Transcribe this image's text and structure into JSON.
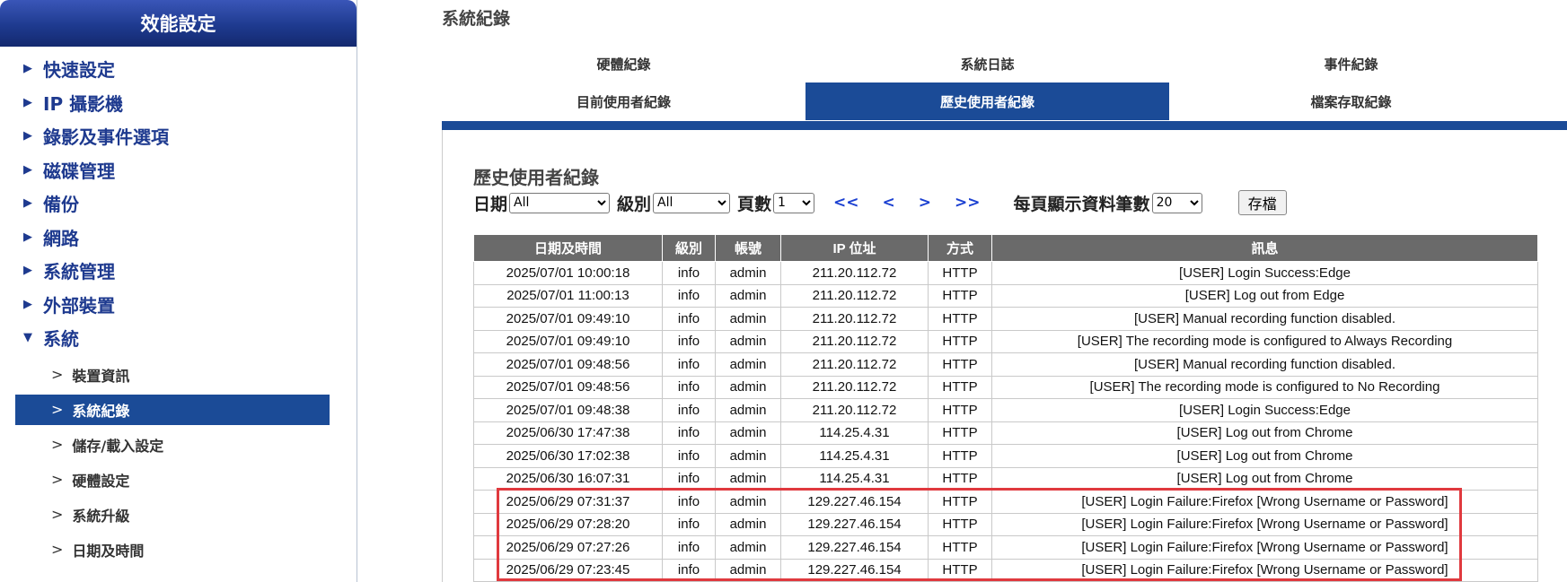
{
  "sidebar": {
    "title": "效能設定",
    "menu": [
      {
        "label": "快速設定"
      },
      {
        "label": "IP 攝影機"
      },
      {
        "label": "錄影及事件選項"
      },
      {
        "label": "磁碟管理"
      },
      {
        "label": "備份"
      },
      {
        "label": "網路"
      },
      {
        "label": "系統管理"
      },
      {
        "label": "外部裝置"
      },
      {
        "label": "系統"
      }
    ],
    "submenu": [
      {
        "label": "裝置資訊"
      },
      {
        "label": "系統紀錄"
      },
      {
        "label": "儲存/載入設定"
      },
      {
        "label": "硬體設定"
      },
      {
        "label": "系統升級"
      },
      {
        "label": "日期及時間"
      }
    ]
  },
  "page_title": "系統紀錄",
  "tabs": {
    "row1": [
      "硬體紀錄",
      "系統日誌",
      "事件紀錄"
    ],
    "row2": [
      "目前使用者紀錄",
      "歷史使用者紀錄",
      "檔案存取紀錄"
    ]
  },
  "section_title": "歷史使用者紀錄",
  "controls": {
    "date_label": "日期",
    "date_value": "All",
    "level_label": "級別",
    "level_value": "All",
    "page_label": "頁數",
    "page_value": "1",
    "first": "<<",
    "prev": "<",
    "next": ">",
    "last": ">>",
    "per_page_label": "每頁顯示資料筆數",
    "per_page_value": "20",
    "save_label": "存檔"
  },
  "table": {
    "headers": [
      "日期及時間",
      "級別",
      "帳號",
      "IP 位址",
      "方式",
      "訊息"
    ],
    "rows": [
      [
        "2025/07/01 10:00:18",
        "info",
        "admin",
        "211.20.112.72",
        "HTTP",
        "[USER] Login Success:Edge"
      ],
      [
        "2025/07/01 11:00:13",
        "info",
        "admin",
        "211.20.112.72",
        "HTTP",
        "[USER] Log out from Edge"
      ],
      [
        "2025/07/01 09:49:10",
        "info",
        "admin",
        "211.20.112.72",
        "HTTP",
        "[USER] Manual recording function disabled."
      ],
      [
        "2025/07/01 09:49:10",
        "info",
        "admin",
        "211.20.112.72",
        "HTTP",
        "[USER] The recording mode is configured to Always Recording"
      ],
      [
        "2025/07/01 09:48:56",
        "info",
        "admin",
        "211.20.112.72",
        "HTTP",
        "[USER] Manual recording function disabled."
      ],
      [
        "2025/07/01 09:48:56",
        "info",
        "admin",
        "211.20.112.72",
        "HTTP",
        "[USER] The recording mode is configured to No Recording"
      ],
      [
        "2025/07/01 09:48:38",
        "info",
        "admin",
        "211.20.112.72",
        "HTTP",
        "[USER] Login Success:Edge"
      ],
      [
        "2025/06/30 17:47:38",
        "info",
        "admin",
        "114.25.4.31",
        "HTTP",
        "[USER] Log out from Chrome"
      ],
      [
        "2025/06/30 17:02:38",
        "info",
        "admin",
        "114.25.4.31",
        "HTTP",
        "[USER] Log out from Chrome"
      ],
      [
        "2025/06/30 16:07:31",
        "info",
        "admin",
        "114.25.4.31",
        "HTTP",
        "[USER] Log out from Chrome"
      ],
      [
        "2025/06/29 07:31:37",
        "info",
        "admin",
        "129.227.46.154",
        "HTTP",
        "[USER] Login Failure:Firefox [Wrong Username or Password]"
      ],
      [
        "2025/06/29 07:28:20",
        "info",
        "admin",
        "129.227.46.154",
        "HTTP",
        "[USER] Login Failure:Firefox [Wrong Username or Password]"
      ],
      [
        "2025/06/29 07:27:26",
        "info",
        "admin",
        "129.227.46.154",
        "HTTP",
        "[USER] Login Failure:Firefox [Wrong Username or Password]"
      ],
      [
        "2025/06/29 07:23:45",
        "info",
        "admin",
        "129.227.46.154",
        "HTTP",
        "[USER] Login Failure:Firefox [Wrong Username or Password]"
      ]
    ]
  },
  "colors": {
    "accent": "#1b4b97",
    "highlight": "#e0393e"
  }
}
